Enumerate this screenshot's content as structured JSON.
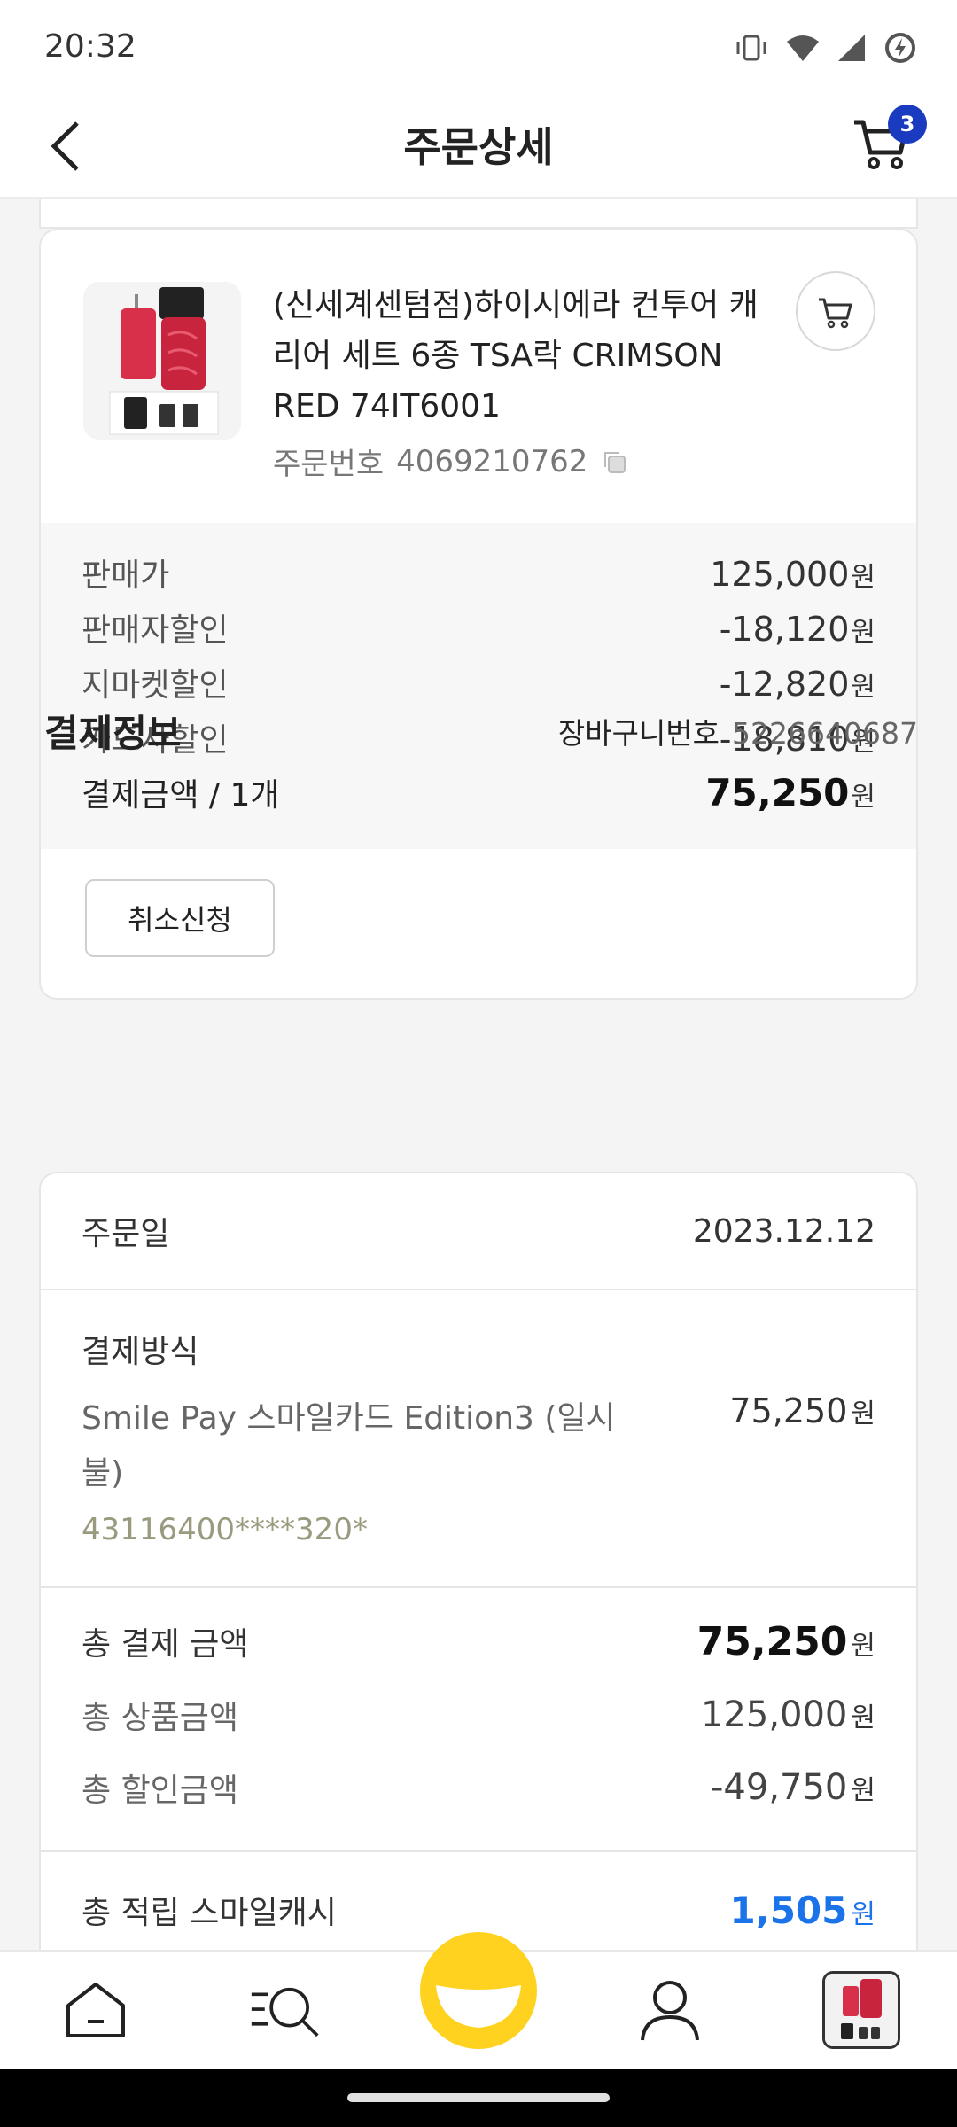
{
  "status": {
    "time": "20:32"
  },
  "header": {
    "title": "주문상세",
    "cart_count": "3"
  },
  "order_item": {
    "product_name": "(신세계센텀점)하이시에라 컨투어 캐리어 세트 6종 TSA락 CRIMSON RED 74IT6001",
    "order_no_label": "주문번호",
    "order_no": "4069210762",
    "prices": [
      {
        "label": "판매가",
        "value": "125,000",
        "unit": "원"
      },
      {
        "label": "판매자할인",
        "value": "-18,120",
        "unit": "원"
      },
      {
        "label": "지마켓할인",
        "value": "-12,820",
        "unit": "원"
      },
      {
        "label": "카드사할인",
        "value": "-18,810",
        "unit": "원"
      }
    ],
    "total_label": "결제금액 / 1개",
    "total_value": "75,250",
    "total_unit": "원",
    "cancel_label": "취소신청"
  },
  "payment": {
    "section_title": "결제정보",
    "basket_label": "장바구니번호",
    "basket_no": "5226640687",
    "order_date_label": "주문일",
    "order_date": "2023.12.12",
    "method_label": "결제방식",
    "method_text": "Smile Pay 스마일카드 Edition3 (일시불)",
    "method_amount": "75,250",
    "method_unit": "원",
    "card_no": "43116400****320*",
    "total_pay_label": "총 결제 금액",
    "total_pay": "75,250",
    "total_goods_label": "총 상품금액",
    "total_goods": "125,000",
    "total_discount_label": "총 할인금액",
    "total_discount": "-49,750",
    "cash_label": "총 적립 스마일캐시",
    "cash_value": "1,505",
    "unit": "원"
  },
  "colors": {
    "accent_blue": "#1a73e8",
    "badge_blue": "#1a3bbf",
    "smile_yellow": "#ffd21f"
  },
  "nav": {
    "items": [
      "home-icon",
      "category-search-icon",
      "smile-icon",
      "user-icon",
      "recent-item-thumb"
    ]
  }
}
